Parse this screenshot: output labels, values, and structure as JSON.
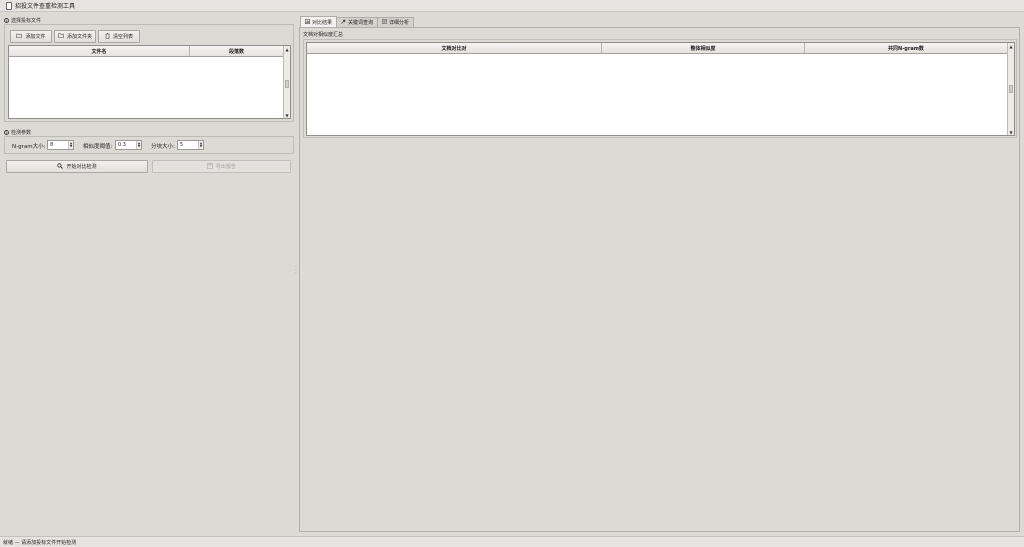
{
  "window": {
    "title": "招投文件查重检测工具"
  },
  "files_group": {
    "title": "选择投标文件",
    "number": "1",
    "buttons": {
      "add_file": "添加文件",
      "add_folder": "添加文件夹",
      "clear_list": "清空列表"
    },
    "table": {
      "columns": [
        "文件名",
        "段落数"
      ],
      "rows": []
    }
  },
  "params_group": {
    "title": "检测参数",
    "number": "2",
    "ngram_label": "N-gram大小:",
    "ngram_value": "8",
    "threshold_label": "相似度阈值:",
    "threshold_value": "0.3",
    "chunk_label": "分块大小:",
    "chunk_value": "5"
  },
  "actions": {
    "start_label": "开始对比检测",
    "export_label": "导出报告"
  },
  "tabs": [
    {
      "label": "对比结果",
      "icon": "chart-icon",
      "active": true
    },
    {
      "label": "关键词查询",
      "icon": "pin-icon",
      "active": false
    },
    {
      "label": "详细分析",
      "icon": "document-icon",
      "active": false
    }
  ],
  "results": {
    "section_title": "文档对相似度汇总",
    "columns": [
      "文档对比对",
      "整体相似度",
      "共同N-gram数"
    ],
    "rows": []
  },
  "status": {
    "text": "就绪 — 请添加投标文件开始检测"
  }
}
